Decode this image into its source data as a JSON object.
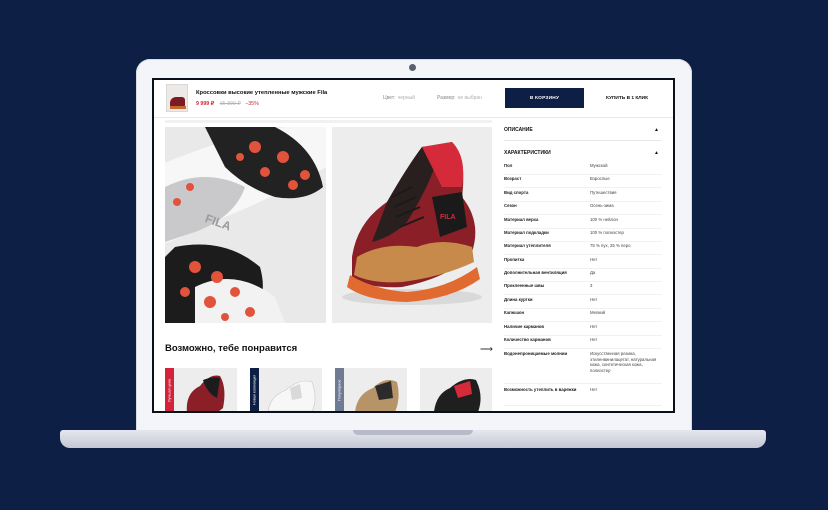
{
  "product": {
    "title": "Кроссовки высокие утепленные мужские Fila",
    "price": "9 999 ₽",
    "old_price": "15 399 ₽",
    "discount": "−35%",
    "color_label": "Цвет:",
    "color_value": "черный",
    "size_label": "Размер:",
    "size_value": "не выбран",
    "cart_button": "В КОРЗИНУ",
    "buy_button": "КУПИТЬ В 1 КЛИК"
  },
  "recommendations": {
    "title": "Возможно, тебе понравится",
    "arrow": "⟶",
    "cards": [
      {
        "tag": "Лучшая цена",
        "tag_color": "#d2233a"
      },
      {
        "tag": "Новая коллекция",
        "tag_color": "#0d1f45"
      },
      {
        "tag": "Популярное",
        "tag_color": "#6f7b93"
      },
      {
        "tag": "",
        "tag_color": ""
      }
    ]
  },
  "panel": {
    "description_label": "ОПИСАНИЕ",
    "characteristics_label": "ХАРАКТЕРИСТИКИ",
    "caret": "▲",
    "rows": [
      {
        "k": "Пол",
        "v": "Мужской"
      },
      {
        "k": "Возраст",
        "v": "Взрослые"
      },
      {
        "k": "Вид спорта",
        "v": "Путешествия"
      },
      {
        "k": "Сезон",
        "v": "Осень-зима"
      },
      {
        "k": "Материал верха",
        "v": "100 % нейлон"
      },
      {
        "k": "Материал подкладки",
        "v": "100 % полиэстер"
      },
      {
        "k": "Материал утеплителя",
        "v": "75 % пух, 25 % перо"
      },
      {
        "k": "Пропитка",
        "v": "Нет"
      },
      {
        "k": "Дополнительная вентиляция",
        "v": "Да"
      },
      {
        "k": "Проклеенные швы",
        "v": "3"
      },
      {
        "k": "Длина куртки",
        "v": "Нет"
      },
      {
        "k": "Капюшон",
        "v": "Мелкий"
      },
      {
        "k": "Наличие карманов",
        "v": "Нет"
      },
      {
        "k": "Количество карманов",
        "v": "Нет"
      },
      {
        "k": "Водонепроницаемые молнии",
        "v": "Искусственная резина, этиленвинилацетат, натуральная кожа, синтетическая кожа, полиэстер"
      },
      {
        "k": "Возможность утеплить в варежки",
        "v": "Нет"
      }
    ]
  },
  "colors": {
    "navy": "#0d1f45",
    "accent_red": "#d2233a"
  }
}
